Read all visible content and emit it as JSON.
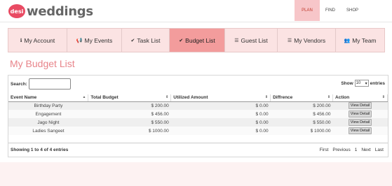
{
  "brand": {
    "badge": "desi",
    "name": "weddings"
  },
  "topnav": [
    "PLAN",
    "FIND",
    "SHOP"
  ],
  "tabs": [
    {
      "label": "My Account",
      "icon": "info-icon",
      "glyph": "ℹ"
    },
    {
      "label": "My Events",
      "icon": "bullhorn-icon",
      "glyph": "📢"
    },
    {
      "label": "Task List",
      "icon": "check-icon",
      "glyph": "✔"
    },
    {
      "label": "Budget List",
      "icon": "check-icon",
      "glyph": "✔"
    },
    {
      "label": "Guest List",
      "icon": "list-icon",
      "glyph": "☰"
    },
    {
      "label": "My Vendors",
      "icon": "list-icon",
      "glyph": "☰"
    },
    {
      "label": "My Team",
      "icon": "users-icon",
      "glyph": "👥"
    }
  ],
  "page": {
    "title": "My Budget List"
  },
  "table_controls": {
    "search_label": "Search:",
    "show_label": "Show",
    "page_size": "10",
    "entries_label": "entries"
  },
  "table": {
    "columns": [
      "Event Name",
      "Total Budget",
      "Utilized Amount",
      "Diffrence",
      "Action"
    ],
    "rows": [
      {
        "event": "Birthday Party",
        "total": "$ 200.00",
        "utilized": "$ 0.00",
        "difference": "$ 200.00",
        "action": "View Detail"
      },
      {
        "event": "Engagement",
        "total": "$ 456.00",
        "utilized": "$ 0.00",
        "difference": "$ 456.00",
        "action": "View Detail"
      },
      {
        "event": "Jago Night",
        "total": "$ 550.00",
        "utilized": "$ 0.00",
        "difference": "$ 550.00",
        "action": "View Detail"
      },
      {
        "event": "Ladies Sangeet",
        "total": "$ 1000.00",
        "utilized": "$ 0.00",
        "difference": "$ 1000.00",
        "action": "View Detail"
      }
    ]
  },
  "footer": {
    "info": "Showing 1 to 4 of 4 entries",
    "pager": [
      "First",
      "Previous",
      "1",
      "Next",
      "Last"
    ]
  },
  "colors": {
    "accent": "#f39c9c",
    "tab_bg": "#fbe3e3",
    "title": "#e8848a",
    "logo_badge": "#e94b63"
  }
}
